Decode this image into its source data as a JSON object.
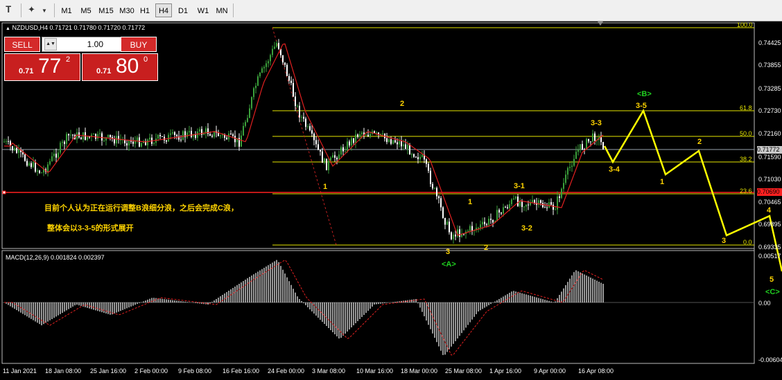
{
  "toolbar": {
    "timeframes": [
      "M1",
      "M5",
      "M15",
      "M30",
      "H1",
      "H4",
      "D1",
      "W1",
      "MN"
    ],
    "active": "H4"
  },
  "chart": {
    "header": "NZDUSD,H4  0.71721 0.71780 0.71720 0.71772",
    "trade_panel": {
      "sell_label": "SELL",
      "buy_label": "BUY",
      "lot": "1.00",
      "sell_prefix": "0.71",
      "sell_big": "77",
      "sell_sup": "2",
      "buy_prefix": "0.71",
      "buy_big": "80",
      "buy_sup": "0"
    },
    "price_axis": [
      "0.74425",
      "0.73855",
      "0.73285",
      "0.72730",
      "0.72160",
      "0.71590",
      "0.71030",
      "0.70465",
      "0.69895",
      "0.69335"
    ],
    "price_tags": {
      "current": "0.71772",
      "red_line": "0.70690"
    },
    "fib_levels": [
      "100.0",
      "61.8",
      "50.0",
      "38.2",
      "23.6",
      "0.0"
    ],
    "wave_labels": {
      "w1": "1",
      "w2": "2",
      "w3": "3",
      "wA": "<A>",
      "w2b": "2",
      "w1b": "1",
      "w31": "3-1",
      "w32": "3-2",
      "w33": "3-3",
      "w34": "3-4",
      "w35": "3-5",
      "wB": "<B>",
      "p1": "1",
      "p2": "2",
      "p3": "3",
      "p4": "4",
      "p5": "5",
      "pC": "<C>"
    },
    "note_line1": "目前个人认为正在运行调整B浪细分浪，之后会完成C浪，",
    "note_line2": "整体会以3-3-5的形式展开",
    "macd": {
      "header": "MACD(12,26,9) 0.001824 0.002397",
      "axis": [
        "0.00517",
        "0.00",
        "-0.00604"
      ]
    },
    "time_axis": [
      "11 Jan 2021",
      "18 Jan 08:00",
      "25 Jan 16:00",
      "2 Feb 00:00",
      "9 Feb 08:00",
      "16 Feb 16:00",
      "24 Feb 00:00",
      "3 Mar 08:00",
      "10 Mar 16:00",
      "18 Mar 00:00",
      "25 Mar 08:00",
      "1 Apr 16:00",
      "9 Apr 00:00",
      "16 Apr 08:00"
    ],
    "colors": {
      "candle_up": "#3ba13b",
      "candle_down": "#ffffff",
      "ma": "#e02020",
      "fib": "#e6e600",
      "projection": "#ffff00",
      "wave_green": "#20d020"
    }
  }
}
